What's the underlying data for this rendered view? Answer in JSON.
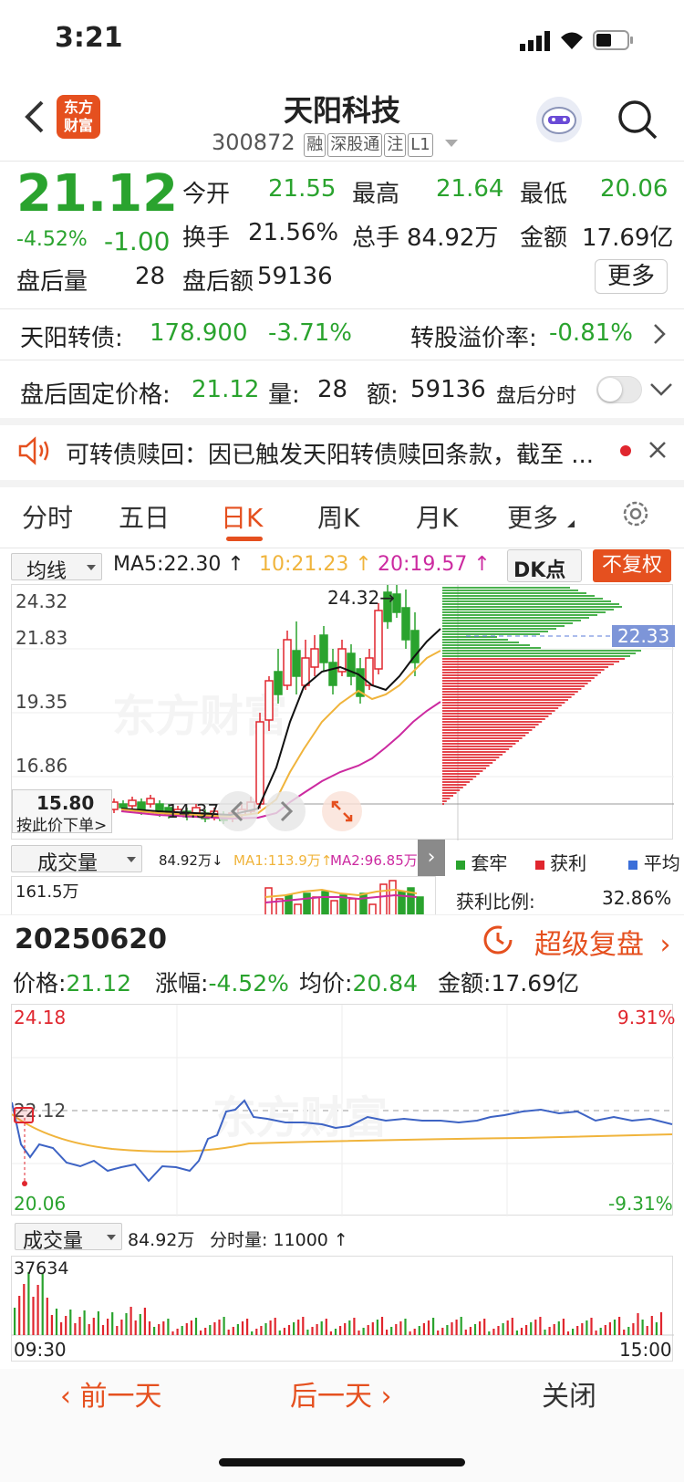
{
  "status_bar": {
    "time": "3:21"
  },
  "header": {
    "logo_text": "东方财富",
    "title": "天阳科技",
    "code": "300872",
    "badges": [
      "融",
      "深股通",
      "注",
      "L1"
    ]
  },
  "quote": {
    "price": "21.12",
    "change_pct": "-4.52%",
    "change": "-1.00",
    "open_label": "今开",
    "open": "21.55",
    "high_label": "最高",
    "high": "21.64",
    "low_label": "最低",
    "low": "20.06",
    "turnover_label": "换手",
    "turnover": "21.56%",
    "volume_label": "总手",
    "volume": "84.92万",
    "amount_label": "金额",
    "amount": "17.69亿",
    "after_vol_label": "盘后量",
    "after_vol": "28",
    "after_amt_label": "盘后额",
    "after_amt": "59136",
    "more_label": "更多"
  },
  "bond": {
    "label": "天阳转债:",
    "price": "178.900",
    "change": "-3.71%",
    "premium_label": "转股溢价率:",
    "premium": "-0.81%"
  },
  "after_hours": {
    "label": "盘后固定价格:",
    "price": "21.12",
    "vol_label": "量:",
    "vol": "28",
    "amt_label": "额:",
    "amt": "59136",
    "toggle_label": "盘后分时"
  },
  "notice": {
    "text": "可转债赎回：因已触发天阳转债赎回条款，截至 ..."
  },
  "tabs": [
    "分时",
    "五日",
    "日K",
    "周K",
    "月K",
    "更多"
  ],
  "active_tab": "日K",
  "kline": {
    "ma_select": "均线",
    "ma5": "MA5:22.30",
    "ma10": "10:21.23",
    "ma20": "20:19.57",
    "dk_label": "DK点",
    "fq_label": "不复权",
    "y_labels": [
      "24.32",
      "21.83",
      "19.35",
      "16.86"
    ],
    "max_label": "24.32→",
    "min_label": "14.37",
    "cursor_price": "15.80",
    "cursor_hint": "按此价下单>",
    "chip_price": "22.33",
    "vol_select": "成交量",
    "vol_value": "84.92万",
    "vol_ma1": "MA1:113.9万",
    "vol_ma2": "MA2:96.85万",
    "vol_max": "161.5万",
    "chip_legend": [
      "套牢",
      "获利",
      "平均"
    ],
    "profit_label": "获利比例:",
    "profit_value": "32.86%"
  },
  "intraday": {
    "date": "20250620",
    "replay_label": "超级复盘",
    "price_label": "价格:",
    "price": "21.12",
    "chg_label": "涨幅:",
    "chg": "-4.52%",
    "avg_label": "均价:",
    "avg": "20.84",
    "amt_label": "金额:",
    "amt": "17.69亿",
    "y_top": "24.18",
    "y_mid": "22.12",
    "y_bot": "20.06",
    "pct_top": "9.31%",
    "pct_bot": "-9.31%",
    "vol_select": "成交量",
    "vol_total": "84.92万",
    "vol_tick": "分时量: 11000",
    "vol_max": "37634",
    "time_start": "09:30",
    "time_end": "15:00"
  },
  "bottom": {
    "prev": "前一天",
    "next": "后一天",
    "close": "关闭"
  },
  "colors": {
    "up": "#e0262e",
    "down": "#2aa32e",
    "accent": "#e5501f",
    "ma10": "#f0b43c",
    "ma20": "#cc2aa0"
  },
  "chart_data": [
    {
      "type": "line",
      "title": "",
      "x": [
        "09:30",
        "15:00"
      ],
      "ylim": [
        20.06,
        24.18
      ],
      "series": []
    }
  ]
}
